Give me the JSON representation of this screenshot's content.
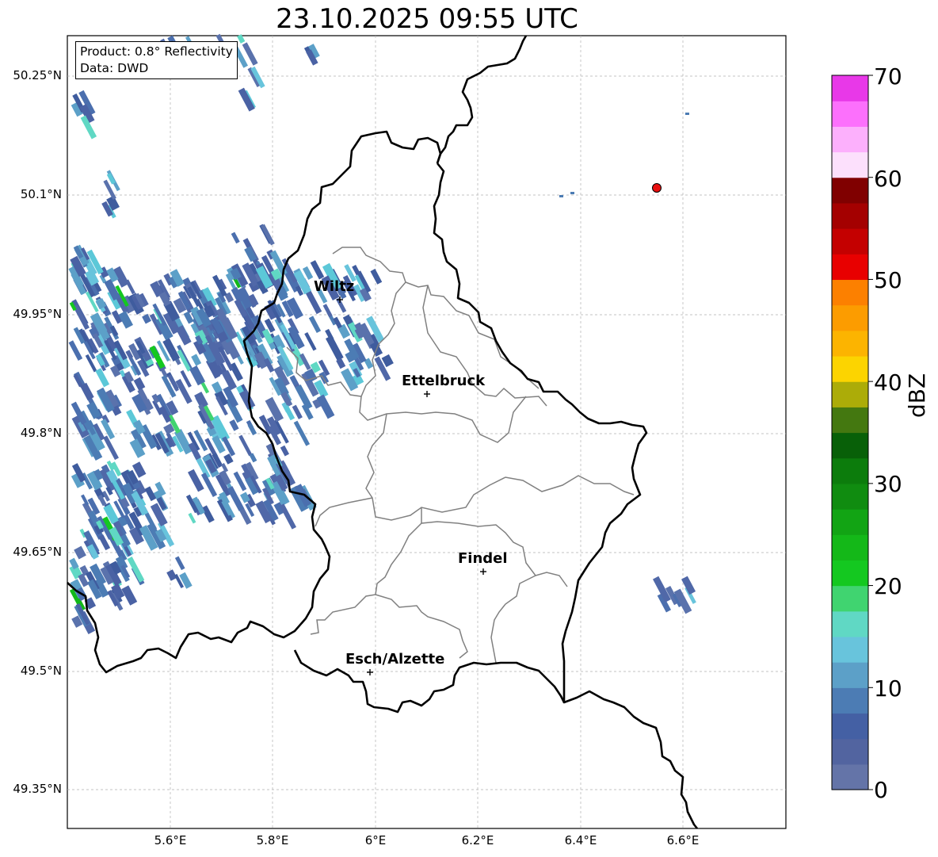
{
  "title": "23.10.2025 09:55 UTC",
  "info": {
    "product": "Product: 0.8° Reflectivity",
    "data": "Data: DWD"
  },
  "lat_labels": [
    "50.25°N",
    "50.1°N",
    "49.95°N",
    "49.8°N",
    "49.65°N",
    "49.5°N",
    "49.35°N"
  ],
  "lon_labels": [
    "5.6°E",
    "5.8°E",
    "6°E",
    "6.2°E",
    "6.4°E",
    "6.6°E"
  ],
  "cities": [
    {
      "name": "Wiltz"
    },
    {
      "name": "Ettelbruck"
    },
    {
      "name": "Findel"
    },
    {
      "name": "Esch/Alzette"
    }
  ],
  "colorbar": {
    "unit": "dBZ",
    "tick_labels": [
      "0",
      "10",
      "20",
      "30",
      "40",
      "50",
      "60",
      "70"
    ],
    "colors": [
      "#6474a8",
      "#5264a0",
      "#4460a4",
      "#4c7cb4",
      "#5ca0c8",
      "#68c4dc",
      "#60d8c4",
      "#40d470",
      "#14c820",
      "#14b818",
      "#12a414",
      "#108c10",
      "#0c7c0c",
      "#086008",
      "#447810",
      "#acac08",
      "#fcd400",
      "#fcb400",
      "#fc9c00",
      "#fc8000",
      "#e80000",
      "#c40000",
      "#a40000",
      "#800000",
      "#fce0fc",
      "#fcb0fc",
      "#fc70fc",
      "#e838e8"
    ]
  },
  "radar_marker_color": "#e81010"
}
